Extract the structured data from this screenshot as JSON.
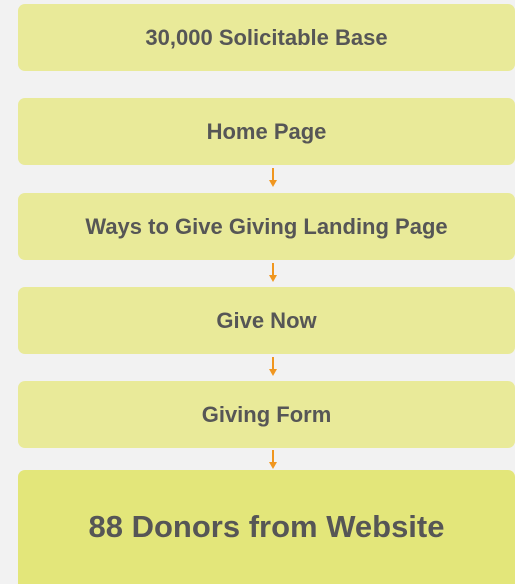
{
  "funnel": {
    "steps": [
      {
        "label": "30,000 Solicitable Base"
      },
      {
        "label": "Home Page"
      },
      {
        "label": "Ways to Give Giving Landing Page"
      },
      {
        "label": "Give Now"
      },
      {
        "label": "Giving Form"
      },
      {
        "label": "88 Donors from Website"
      }
    ],
    "colors": {
      "box": "#e9ea99",
      "final_box": "#e3e67a",
      "text": "#565656",
      "arrow": "#f0961f",
      "background": "#f2f2f2"
    }
  }
}
